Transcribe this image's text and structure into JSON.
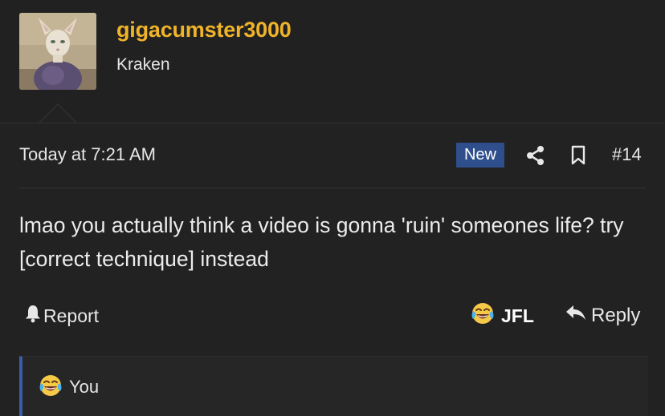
{
  "user": {
    "username": "gigacumster3000",
    "title": "Kraken"
  },
  "post": {
    "timestamp": "Today at 7:21 AM",
    "badge": "New",
    "number": "#14",
    "body": "lmao you actually think a video is gonna 'ruin' someones life? try [correct technique] instead"
  },
  "actions": {
    "report": "Report",
    "jfl": "JFL",
    "reply": "Reply"
  },
  "reactions": {
    "text": "You"
  },
  "colors": {
    "background": "#212121",
    "username": "#f0b429",
    "badge": "#2f4e8c",
    "reaction_accent": "#3b5ea8"
  },
  "icons": [
    "share-icon",
    "bookmark-icon",
    "bell-icon",
    "crying-laughing-emoji",
    "reply-icon"
  ]
}
